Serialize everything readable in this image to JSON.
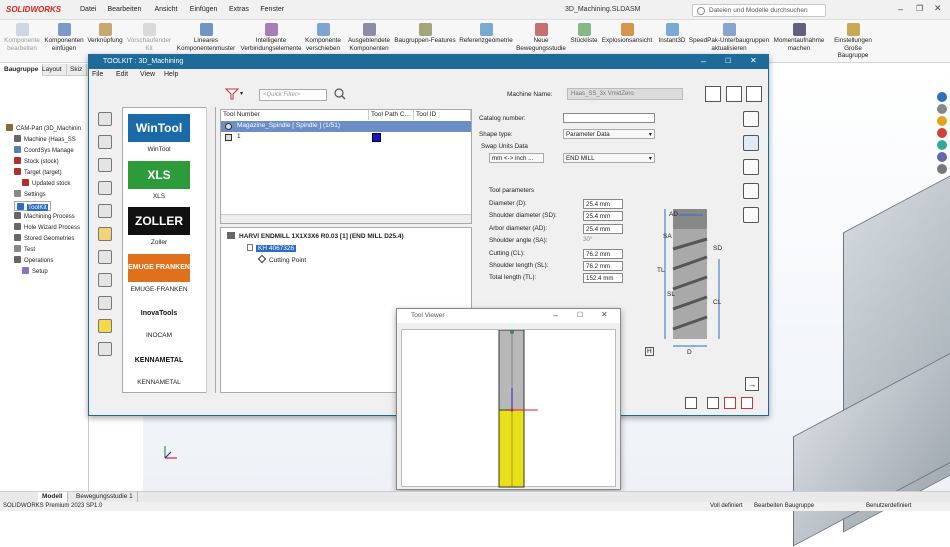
{
  "app": {
    "logo": "SOLIDWORKS",
    "doc_title": "3D_Machining.SLDASM",
    "menus": [
      "Datei",
      "Bearbeiten",
      "Ansicht",
      "Einfügen",
      "Extras",
      "Fenster"
    ],
    "search_placeholder": "Dateien und Modelle durchsuchen"
  },
  "ribbon": [
    {
      "label": "Komponente bearbeiten",
      "disabled": true
    },
    {
      "label": "Komponenten einfügen"
    },
    {
      "label": "Verknüpfung"
    },
    {
      "label": "Vorschaufender Kit",
      "disabled": true
    },
    {
      "label": "Lineares Komponentenmuster"
    },
    {
      "label": "Intelligente Verbindungselemente"
    },
    {
      "label": "Komponente verschieben"
    },
    {
      "label": "Ausgeblendete Komponenten"
    },
    {
      "label": "Baugruppen-Features"
    },
    {
      "label": "Referenzgeometrie"
    },
    {
      "label": "Neue Bewegungsstudie"
    },
    {
      "label": "Stückliste"
    },
    {
      "label": "Explosionsansicht"
    },
    {
      "label": "Instant3D"
    },
    {
      "label": "SpeedPak-Unterbaugruppen aktualisieren"
    },
    {
      "label": "Momentaufnahme machen"
    },
    {
      "label": "Einstellungen Große Baugruppe"
    }
  ],
  "left_tabs": [
    "Baugruppe",
    "Layout",
    "Skiz"
  ],
  "tree": [
    {
      "label": "CAM-Part (3D_Machinin",
      "indent": 0
    },
    {
      "label": "Machine (Haas_SS",
      "indent": 1
    },
    {
      "label": "CoordSys Manage",
      "indent": 1
    },
    {
      "label": "Stock (stock)",
      "indent": 1
    },
    {
      "label": "Target (target)",
      "indent": 1
    },
    {
      "label": "Updated stock",
      "indent": 2
    },
    {
      "label": "Settings",
      "indent": 1
    },
    {
      "label": "ToolKit",
      "indent": 1,
      "selected": true
    },
    {
      "label": "Machining Process",
      "indent": 1
    },
    {
      "label": "Hole Wizard Process",
      "indent": 1
    },
    {
      "label": "Stored Geometries",
      "indent": 1
    },
    {
      "label": "Test",
      "indent": 1
    },
    {
      "label": "Operations",
      "indent": 1
    },
    {
      "label": "Setup",
      "indent": 2
    }
  ],
  "toolkit": {
    "title": "TOOLKIT : 3D_Machining",
    "menu": [
      "File",
      "Edit",
      "View",
      "Help"
    ],
    "quick_filter": "<Quick Filter>",
    "machine_name_label": "Machine Name:",
    "machine_name_value": "Haas_SS_3x VmidZero",
    "vendors": [
      {
        "name": "WinTool",
        "logo": "WinTool",
        "color": "#1b6aa8"
      },
      {
        "name": "XLS",
        "logo": "XLS",
        "color": "#2d9b3a"
      },
      {
        "name": "Zoller",
        "logo": "ZOLLER",
        "color": "#111111"
      },
      {
        "name": "EMUGE-FRANKEN",
        "logo": "EMUGE FRANKEN",
        "color": "#e0701c"
      },
      {
        "name": "INOCAM",
        "logo": "InovaTools",
        "color": "#ffffff"
      },
      {
        "name": "KENNAMETAL",
        "logo": "KENNAMETAL",
        "color": "#ffffff"
      }
    ],
    "grid_headers": [
      "Tool Number",
      "Tool Path C...",
      "Tool ID"
    ],
    "grid_rows": [
      {
        "label": "Magazine_Spindle [ Spindle ] (1/51)"
      },
      {
        "label": "1"
      }
    ],
    "tool_tree": {
      "title": "HARVI ENDMILL 1X1X3X6 R0.03 [1] (END MILL D25.4)",
      "child": "KH 4067326",
      "leaf": "Cutting Point"
    },
    "props": {
      "catalog_label": "Catalog number:",
      "shape_type_label": "Shape type:",
      "shape_type_value": "Parameter Data",
      "swap_units_label": "Swap Units Data",
      "swap_button": "mm <-> inch ...",
      "end_mill": "END MILL",
      "tool_params_label": "Tool parameters",
      "params": [
        {
          "label": "Diameter (D):",
          "value": "25.4 mm"
        },
        {
          "label": "Shoulder diameter (SD):",
          "value": "25.4 mm"
        },
        {
          "label": "Arbor diameter (AD):",
          "value": "25.4 mm"
        },
        {
          "label": "Shoulder angle (SA):",
          "value": "30°"
        },
        {
          "label": "Cutting (CL):",
          "value": "76.2 mm"
        },
        {
          "label": "Shoulder length (SL):",
          "value": "76.2 mm"
        },
        {
          "label": "Total length (TL):",
          "value": "152.4 mm"
        }
      ],
      "dims": [
        "AD",
        "SA",
        "SD",
        "TL",
        "SL",
        "CL",
        "D",
        "H"
      ]
    }
  },
  "tool_viewer": {
    "title": "Tool Viewer"
  },
  "bottom_tabs": [
    "Modell",
    "Bewegungsstudie 1"
  ],
  "status": {
    "left": "SOLIDWORKS Premium 2023 SP1.0",
    "mid1": "Voll definiert",
    "mid2": "Bearbeiten Baugruppe",
    "right": "Benutzerdefiniert"
  },
  "colors": {
    "accent": "#1e6a9b",
    "selection": "#2b6cc4",
    "tool_yellow": "#e8e11a"
  }
}
